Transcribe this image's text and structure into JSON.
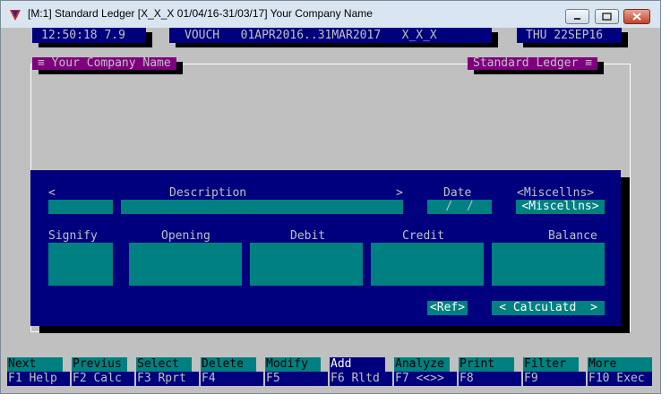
{
  "window": {
    "title": "[M:1] Standard Ledger [X_X_X 01/04/16-31/03/17] Your Company Name"
  },
  "status_bar": {
    "time": "12:50:18 7.9",
    "context": "VOUCH   01APR2016..31MAR2017   X_X_X",
    "date": "THU 22SEP16"
  },
  "frame_tabs": {
    "left": "≡ Your Company Name",
    "right": "Standard Ledger ≡"
  },
  "form": {
    "lt_marker": "<",
    "gt_marker": ">",
    "description_label": "Description",
    "date_label": "Date",
    "date_value": "/  /",
    "miscellns_label": "<Miscellns>",
    "miscellns_button": "<Miscellns>",
    "signify_label": "Signify",
    "opening_label": "Opening",
    "debit_label": "Debit",
    "credit_label": "Credit",
    "balance_label": "Balance",
    "ref_button": "<Ref>",
    "calculatd_button": "< Calculatd  >"
  },
  "function_keys": [
    {
      "action": "Next",
      "key": "F1 Help"
    },
    {
      "action": "Previus",
      "key": "F2 Calc"
    },
    {
      "action": "Select",
      "key": "F3 Rprt"
    },
    {
      "action": "Delete",
      "key": "F4"
    },
    {
      "action": "Modify",
      "key": "F5"
    },
    {
      "action": "Add",
      "key": "F6 Rltd"
    },
    {
      "action": "Analyze",
      "key": "F7 <<>>"
    },
    {
      "action": "Print",
      "key": "F8"
    },
    {
      "action": "Filter",
      "key": "F9"
    },
    {
      "action": "More",
      "key": "F10 Exec"
    }
  ],
  "colors": {
    "background": "#c0c0c0",
    "navy": "#00007f",
    "teal": "#008080",
    "purple": "#7f007f"
  }
}
